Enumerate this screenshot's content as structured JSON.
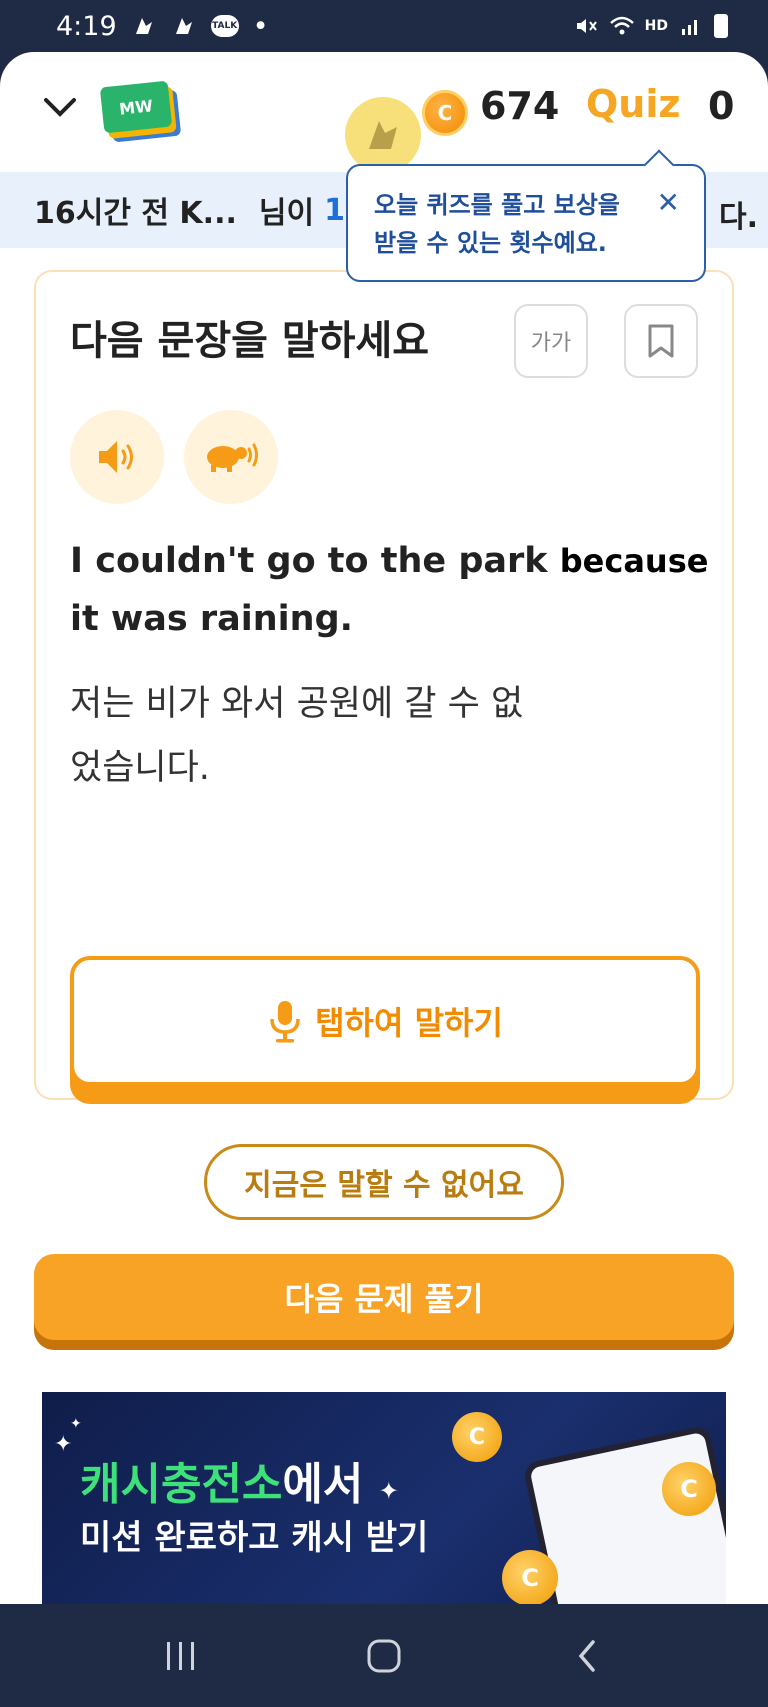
{
  "status_bar": {
    "time": "4:19",
    "talk_label": "TALK",
    "dot": "•",
    "hd_label": "HD"
  },
  "header": {
    "logo_text": "MW",
    "coins": "674",
    "quiz_label": "Quiz",
    "quiz_count": "0"
  },
  "notice": {
    "prefix": "16시간 전 K...",
    "middle": "님이",
    "highlight": "1,",
    "suffix": "다."
  },
  "tooltip": {
    "line1": "오늘 퀴즈를 풀고 보상을",
    "line2": "받을 수 있는 횟수예요.",
    "close": "✕"
  },
  "card": {
    "title": "다음 문장을 말하세요",
    "font_size_label": "가가",
    "sentence_en_part1": "I couldn't go to the park ",
    "sentence_en_highlight": "because",
    "sentence_en_part2": " it was raining.",
    "sentence_ko": "저는 비가 와서 공원에 갈 수 없었습니다.",
    "speak_button": "탭하여 말하기"
  },
  "actions": {
    "cannot_speak": "지금은 말할 수 없어요",
    "next_question": "다음 문제 풀기"
  },
  "banner": {
    "title_green": "캐시충전소",
    "title_white": "에서",
    "subtitle": "미션 완료하고 캐시 받기"
  },
  "colors": {
    "accent_orange": "#f8a325",
    "tooltip_blue": "#2b5fa8",
    "notice_bg": "#e8f1fb",
    "nav_bg": "#1f2a44"
  },
  "icons": [
    "chevron-down-icon",
    "coin-icon",
    "speaker-icon",
    "turtle-speaker-icon",
    "bookmark-icon",
    "mic-icon",
    "recent-apps-icon",
    "home-icon",
    "back-icon"
  ]
}
